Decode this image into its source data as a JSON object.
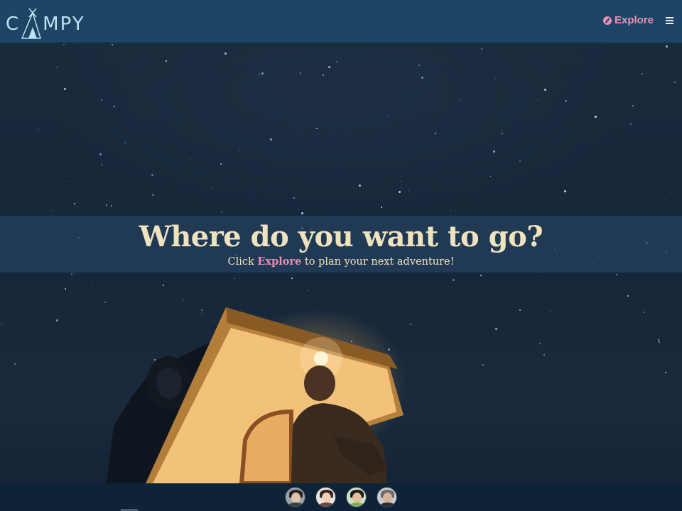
{
  "header": {
    "logo_text": "MPY",
    "logo_letter": "C",
    "nav_explore_label": "Explore"
  },
  "banner": {
    "title": "Where do you want to go?",
    "subtitle_before": "Click ",
    "subtitle_link": "Explore",
    "subtitle_after": " to plan your next adventure!"
  },
  "footer": {
    "avatars": [
      {
        "name": "avatar-1"
      },
      {
        "name": "avatar-2"
      },
      {
        "name": "avatar-3"
      },
      {
        "name": "avatar-4"
      }
    ]
  },
  "colors": {
    "header_bg": "#1c4566",
    "accent_pink": "#ec8fb3",
    "banner_text": "#efe3bf",
    "footer_bg": "#0f2338"
  },
  "icons": [
    "tent-logo-icon",
    "compass-icon",
    "menu-icon"
  ]
}
